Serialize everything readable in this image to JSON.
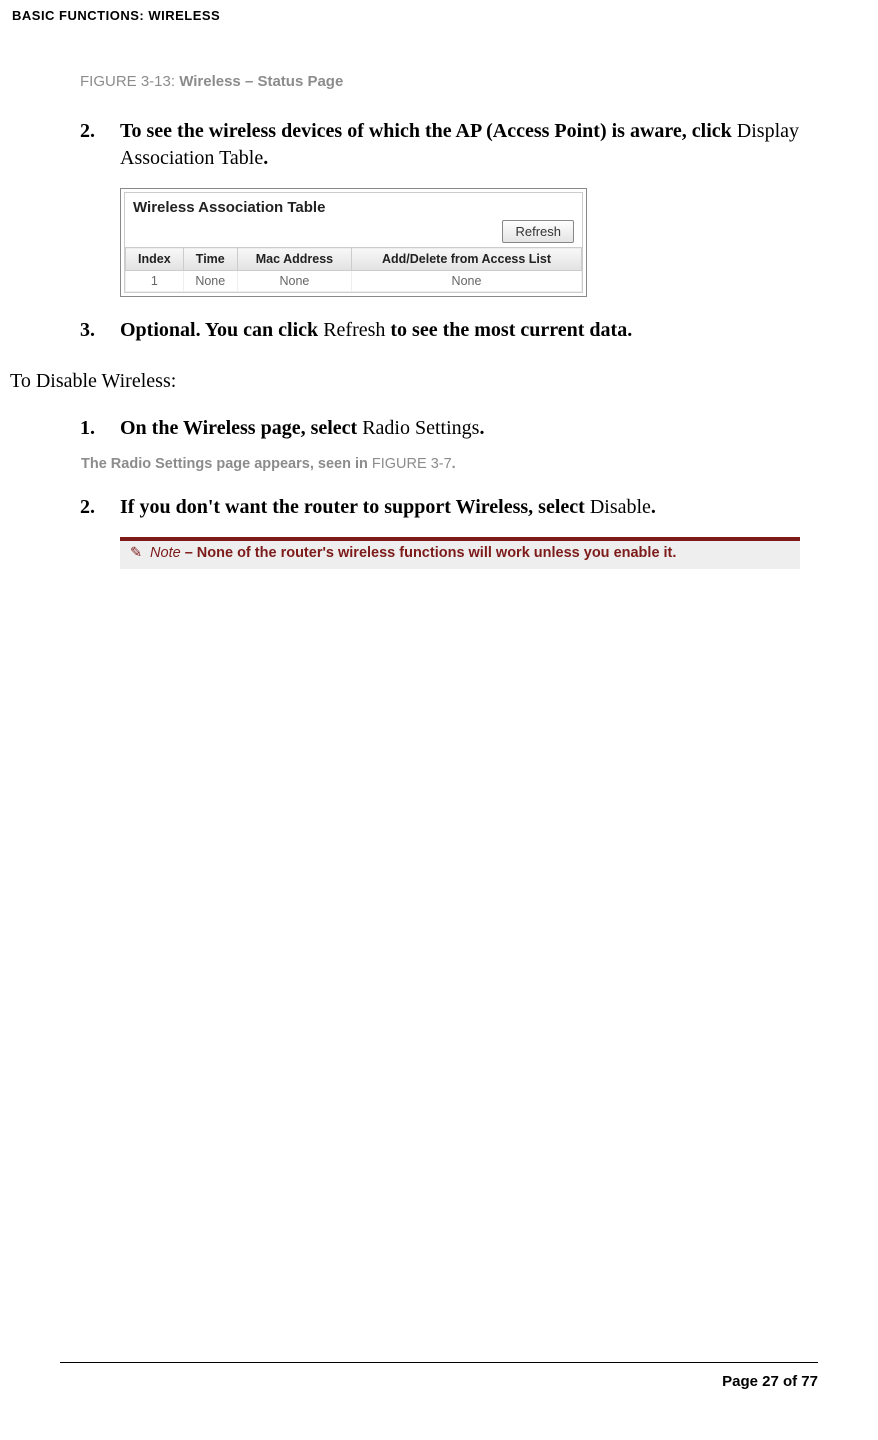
{
  "header": "BASIC FUNCTIONS: WIRELESS",
  "figure": {
    "num": "FIGURE 3-13",
    "colon": ":",
    "title": "Wireless – Status Page"
  },
  "steps_a": [
    {
      "num": "2.",
      "bold_a": "To see the wireless devices of which the AP (Access Point) is aware, click ",
      "plain_a": "Display Association Table",
      "bold_b": "."
    },
    {
      "num": "3.",
      "bold_a": "Optional. You can click ",
      "plain_a": "Refresh",
      "bold_b": " to see the most current data."
    }
  ],
  "embedded": {
    "title": "Wireless Association Table",
    "refresh": "Refresh",
    "columns": [
      "Index",
      "Time",
      "Mac Address",
      "Add/Delete from Access List"
    ],
    "rows": [
      {
        "index": "1",
        "time": "None",
        "mac": "None",
        "action": "None"
      }
    ]
  },
  "section_lead": "To Disable Wireless:",
  "steps_b": [
    {
      "num": "1.",
      "bold_a": "On the Wireless page, select ",
      "plain_a": "Radio Settings",
      "bold_b": "."
    },
    {
      "num": "2.",
      "bold_a": "If you don't want the router to support Wireless, select ",
      "plain_a": "Disable",
      "bold_b": "."
    }
  ],
  "radio_caption": {
    "bold_a": "The Radio Settings page appears, seen in ",
    "ref": "FIGURE 3-7",
    "bold_b": "."
  },
  "note": {
    "pencil": "✎",
    "label": " Note",
    "text": " – None of the router's wireless functions will work unless you enable it."
  },
  "footer": "Page 27 of 77"
}
